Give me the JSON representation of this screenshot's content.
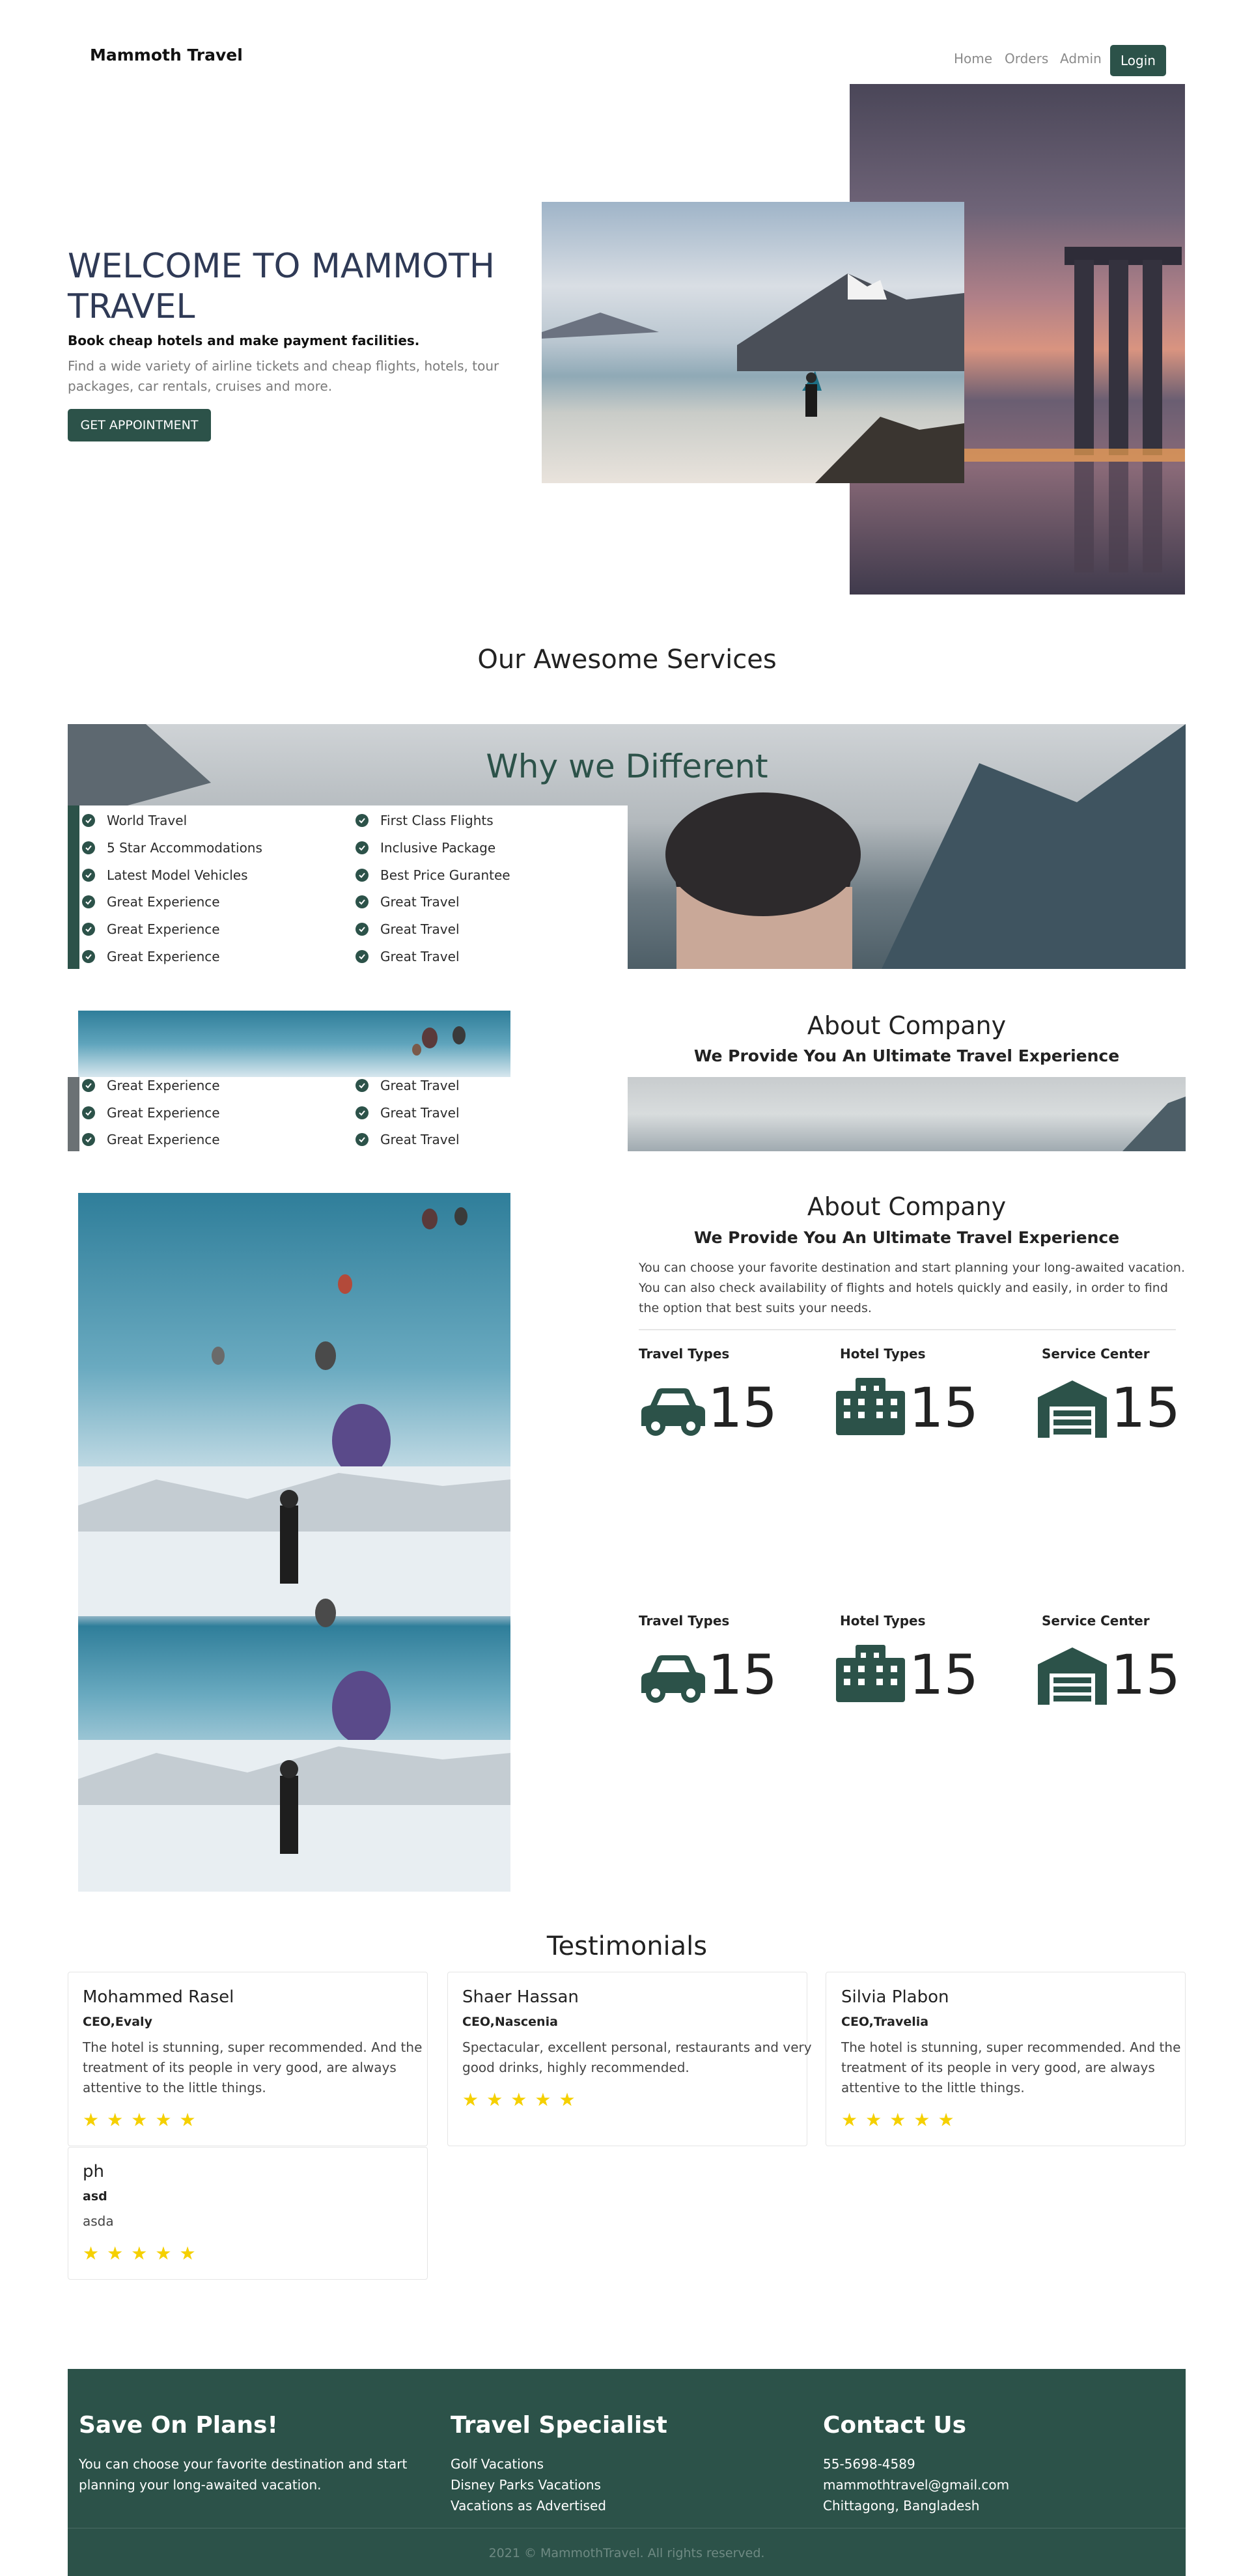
{
  "nav": {
    "brand": "Mammoth Travel",
    "links": [
      "Home",
      "Orders",
      "Admin"
    ],
    "login": "Login"
  },
  "hero": {
    "title_line1": "WELCOME TO MAMMOTH",
    "title_line2": "TRAVEL",
    "subtitle": "Book cheap hotels and make payment facilities.",
    "desc_line1": "Find a wide variety of airline tickets and cheap flights, hotels, tour",
    "desc_line2": "packages, car rentals, cruises and more.",
    "cta": "GET APPOINTMENT"
  },
  "services": {
    "heading": "Our Awesome Services"
  },
  "why": {
    "heading": "Why we Different",
    "left": [
      "World Travel",
      "5 Star Accommodations",
      "Latest Model Vehicles",
      "Great Experience",
      "Great Experience",
      "Great Experience"
    ],
    "right": [
      "First Class Flights",
      "Inclusive Package",
      "Best Price Gurantee",
      "Great Travel",
      "Great Travel",
      "Great Travel"
    ],
    "overflow_left": [
      "Great Experience",
      "Great Experience",
      "Great Experience"
    ],
    "overflow_right": [
      "Great Travel",
      "Great Travel",
      "Great Travel"
    ]
  },
  "about_ghost": {
    "heading": "About Company",
    "subheading": "We Provide You An Ultimate Travel Experience"
  },
  "about": {
    "heading": "About Company",
    "subheading": "We Provide You An Ultimate Travel Experience",
    "p_line1": "You can choose your favorite destination and start planning your long-awaited vacation.",
    "p_line2": "You can also check availability of flights and hotels quickly and easily, in order to find",
    "p_line3": "the option that best suits your needs.",
    "stats": [
      {
        "label": "Travel Types",
        "value": "15",
        "icon": "car-icon"
      },
      {
        "label": "Hotel Types",
        "value": "15",
        "icon": "building-icon"
      },
      {
        "label": "Service Center",
        "value": "15",
        "icon": "warehouse-icon"
      }
    ],
    "stats2": [
      {
        "label": "Travel Types",
        "value": "15",
        "icon": "car-icon"
      },
      {
        "label": "Hotel Types",
        "value": "15",
        "icon": "building-icon"
      },
      {
        "label": "Service Center",
        "value": "15",
        "icon": "warehouse-icon"
      }
    ]
  },
  "testimonials": {
    "heading": "Testimonials",
    "items": [
      {
        "name": "Mohammed Rasel",
        "role": "CEO,Evaly",
        "line1": "The hotel is stunning, super recommended. And the",
        "line2": "treatment of its people in very good, are always",
        "line3": "attentive to the little things.",
        "rating": 5
      },
      {
        "name": "Shaer Hassan",
        "role": "CEO,Nascenia",
        "line1": "Spectacular, excellent personal, restaurants and very",
        "line2": "good drinks, highly recommended.",
        "line3": "",
        "rating": 5
      },
      {
        "name": "Silvia Plabon",
        "role": "CEO,Travelia",
        "line1": "The hotel is stunning, super recommended. And the",
        "line2": "treatment of its people in very good, are always",
        "line3": "attentive to the little things.",
        "rating": 5
      },
      {
        "name": "ph",
        "role": "asd",
        "line1": "asda",
        "line2": "",
        "line3": "",
        "rating": 5
      }
    ]
  },
  "footer": {
    "col1": {
      "heading": "Save On Plans!",
      "line1": "You can choose your favorite destination and start",
      "line2": "planning your long-awaited vacation."
    },
    "col2": {
      "heading": "Travel Specialist",
      "items": [
        "Golf Vacations",
        "Disney Parks Vacations",
        "Vacations as Advertised"
      ]
    },
    "col3": {
      "heading": "Contact Us",
      "items": [
        "55-5698-4589",
        "mammothtravel@gmail.com",
        "Chittagong, Bangladesh"
      ]
    },
    "copyright": "2021 © MammothTravel. All rights reserved."
  },
  "colors": {
    "accent": "#2c5249",
    "star": "#f5d000"
  }
}
